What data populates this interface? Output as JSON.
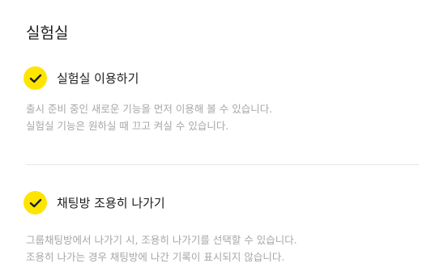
{
  "section": {
    "title": "실험실"
  },
  "options": [
    {
      "label": "실험실 이용하기",
      "checked": true,
      "description": [
        "출시 준비 중인 새로운 기능을 먼저 이용해 볼 수 있습니다.",
        "실험실 기능은 원하실 때 끄고 켜실 수 있습니다."
      ]
    },
    {
      "label": "채팅방 조용히 나가기",
      "checked": true,
      "description": [
        "그룹채팅방에서 나가기 시, 조용히 나가기를 선택할 수 있습니다.",
        "조용히 나가는 경우 채팅방에 나간 기록이 표시되지 않습니다."
      ]
    }
  ],
  "colors": {
    "check_fill": "#fee500",
    "check_mark": "#1e1e1e",
    "title_text": "#1e1e1e",
    "description_text": "#a7a7a7",
    "divider": "#e6e6e6"
  },
  "icons": {
    "checkbox": "check-icon"
  }
}
